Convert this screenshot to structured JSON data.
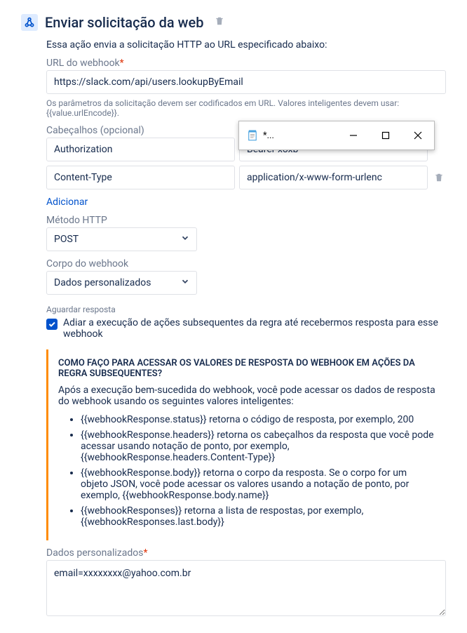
{
  "header": {
    "title": "Enviar solicitação da web"
  },
  "description": "Essa ação envia a solicitação HTTP ao URL especificado abaixo:",
  "webhook_url": {
    "label": "URL do webhook",
    "value": "https://slack.com/api/users.lookupByEmail",
    "hint": "Os parâmetros da solicitação devem ser codificados em URL. Valores inteligentes devem usar: {{value.urlEncode}}."
  },
  "headers": {
    "label": "Cabeçalhos (opcional)",
    "rows": [
      {
        "key": "Authorization",
        "value": "Bearer xoxb"
      },
      {
        "key": "Content-Type",
        "value": "application/x-www-form-urlenc"
      }
    ],
    "add_label": "Adicionar"
  },
  "method": {
    "label": "Método HTTP",
    "value": "POST"
  },
  "body_type": {
    "label": "Corpo do webhook",
    "value": "Dados personalizados"
  },
  "wait": {
    "section": "Aguardar resposta",
    "label": "Adiar a execução de ações subsequentes da regra até recebermos resposta para esse webhook"
  },
  "callout": {
    "title": "COMO FAÇO PARA ACESSAR OS VALORES DE RESPOSTA DO WEBHOOK EM AÇÕES DA REGRA SUBSEQUENTES?",
    "intro": "Após a execução bem-sucedida do webhook, você pode acessar os dados de resposta do webhook usando os seguintes valores inteligentes:",
    "items": [
      "{{webhookResponse.status}} retorna o código de resposta, por exemplo, 200",
      "{{webhookResponse.headers}} retorna os cabeçalhos da resposta que você pode acessar usando notação de ponto, por exemplo, {{webhookResponse.headers.Content-Type}}",
      "{{webhookResponse.body}} retorna o corpo da resposta. Se o corpo for um objeto JSON, você pode acessar os valores usando a notação de ponto, por exemplo, {{webhookResponse.body.name}}",
      "{{webhookResponses}} retorna a lista de respostas, por exemplo, {{webhookResponses.last.body}}"
    ]
  },
  "custom_data": {
    "label": "Dados personalizados",
    "value": "email=xxxxxxxx@yahoo.com.br"
  },
  "float_window": {
    "title": "*..."
  }
}
